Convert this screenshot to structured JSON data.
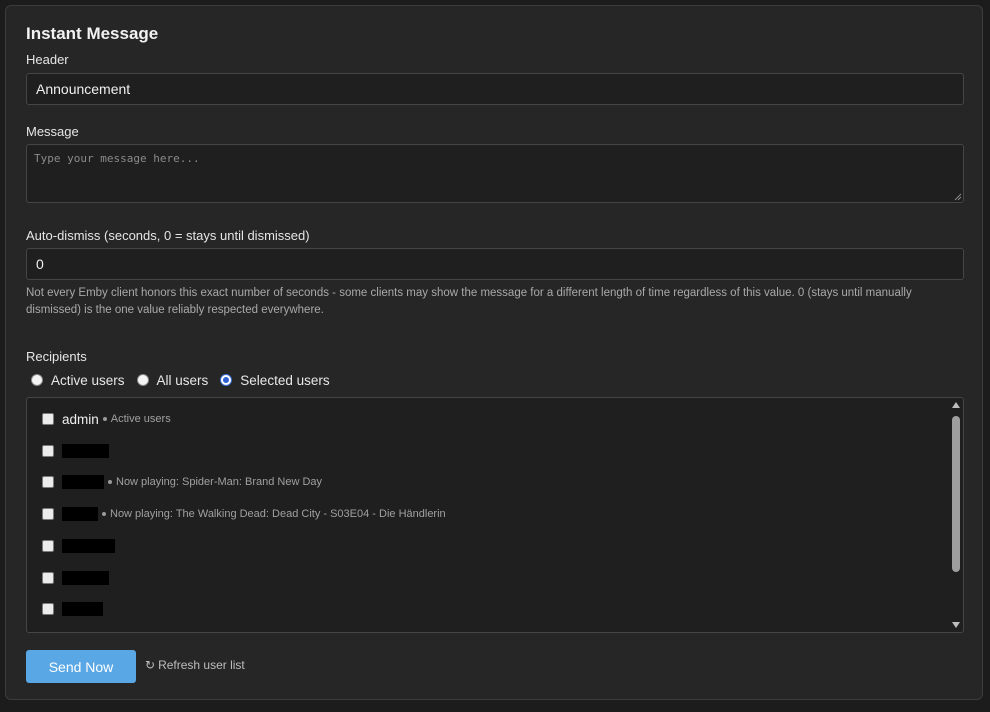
{
  "panel": {
    "title": "Instant Message"
  },
  "header_field": {
    "label": "Header",
    "value": "Announcement"
  },
  "message_field": {
    "label": "Message",
    "placeholder": "Type your message here...",
    "value": ""
  },
  "auto_dismiss": {
    "label": "Auto-dismiss (seconds, 0 = stays until dismissed)",
    "value": "0",
    "hint": "Not every Emby client honors this exact number of seconds - some clients may show the message for a different length of time regardless of this value. 0 (stays until manually dismissed) is the one value reliably respected everywhere."
  },
  "recipients": {
    "label": "Recipients",
    "options": [
      {
        "label": "Active users",
        "checked": false
      },
      {
        "label": "All users",
        "checked": false
      },
      {
        "label": "Selected users",
        "checked": true
      }
    ],
    "users": [
      {
        "name": "admin",
        "redacted": false,
        "status": "Active users",
        "checked": false
      },
      {
        "name": "",
        "redacted": true,
        "status": "",
        "checked": false
      },
      {
        "name": "",
        "redacted": true,
        "status": "Now playing: Spider-Man: Brand New Day",
        "checked": false
      },
      {
        "name": "",
        "redacted": true,
        "status": "Now playing: The Walking Dead: Dead City - S03E04 - Die Händlerin",
        "checked": false
      },
      {
        "name": "",
        "redacted": true,
        "status": "",
        "checked": false
      },
      {
        "name": "",
        "redacted": true,
        "status": "",
        "checked": false
      },
      {
        "name": "",
        "redacted": true,
        "status": "",
        "checked": false
      }
    ]
  },
  "actions": {
    "send_label": "Send Now",
    "refresh_label": "Refresh user list",
    "refresh_icon": "refresh-icon"
  },
  "colors": {
    "background": "#262626",
    "send_button": "#5aa7e6",
    "radio_selected": "#2f5fd3"
  }
}
